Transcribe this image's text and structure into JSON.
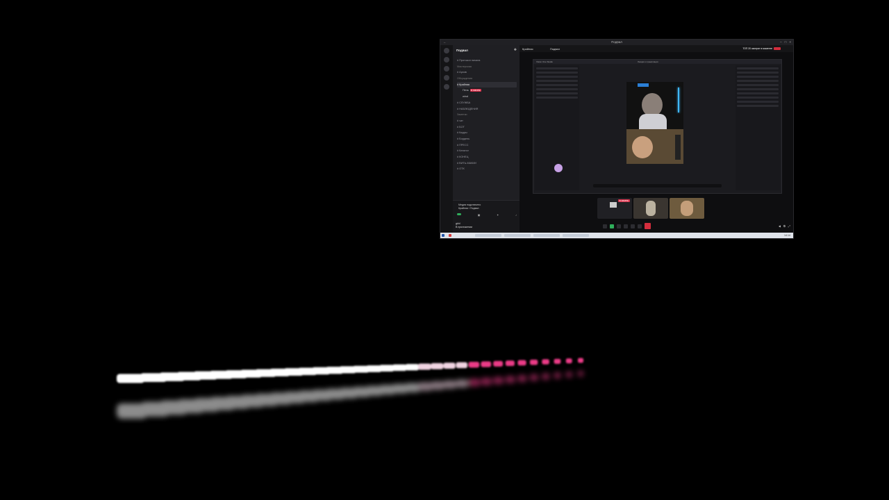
{
  "window": {
    "title": "Подвал",
    "back_label": "←"
  },
  "discord": {
    "guild_name": "Подвал",
    "channels": [
      {
        "label": "Протокол начала",
        "kind": "text"
      },
      {
        "label": "Мастерская",
        "kind": "cat"
      },
      {
        "label": "Архив",
        "kind": "text"
      },
      {
        "label": "Обсуждения",
        "kind": "cat"
      },
      {
        "label": "Крайняя",
        "kind": "active"
      },
      {
        "label": "Печь",
        "kind": "vc",
        "live": "В ЭФИРЕ"
      },
      {
        "label": "wind",
        "kind": "vc"
      },
      {
        "label": "СЛУЖБА",
        "kind": "text"
      },
      {
        "label": "НАБЛЮДЕНИЯ",
        "kind": "text"
      },
      {
        "label": "Заметки",
        "kind": "cat"
      },
      {
        "label": "чат",
        "kind": "text"
      },
      {
        "label": "БОТ",
        "kind": "text"
      },
      {
        "label": "Кадры",
        "kind": "text"
      },
      {
        "label": "Бордель",
        "kind": "text"
      },
      {
        "label": "ПРЕСС",
        "kind": "text"
      },
      {
        "label": "Каталог",
        "kind": "text"
      },
      {
        "label": "КОНЕЦ",
        "kind": "text"
      },
      {
        "label": "ВИТЬ-МАКИИ",
        "kind": "text"
      },
      {
        "label": "ОТК",
        "kind": "text"
      }
    ],
    "voice_status": "Медиа подключено",
    "voice_channel": "Крайняя / Подвал",
    "user_name": "gkhl",
    "user_status": "В приложении"
  },
  "call": {
    "tabs": [
      {
        "label": "Крайняя"
      },
      {
        "label": "Подвал"
      }
    ],
    "top_badge": "ТОП 20 смотрят в моменте",
    "live_label": "В ЭФИРЕ",
    "stream_title": "Лекция и трансляция",
    "stream_sublabel": "Vision One Studio"
  },
  "taskbar": {
    "clock": "14:14"
  }
}
